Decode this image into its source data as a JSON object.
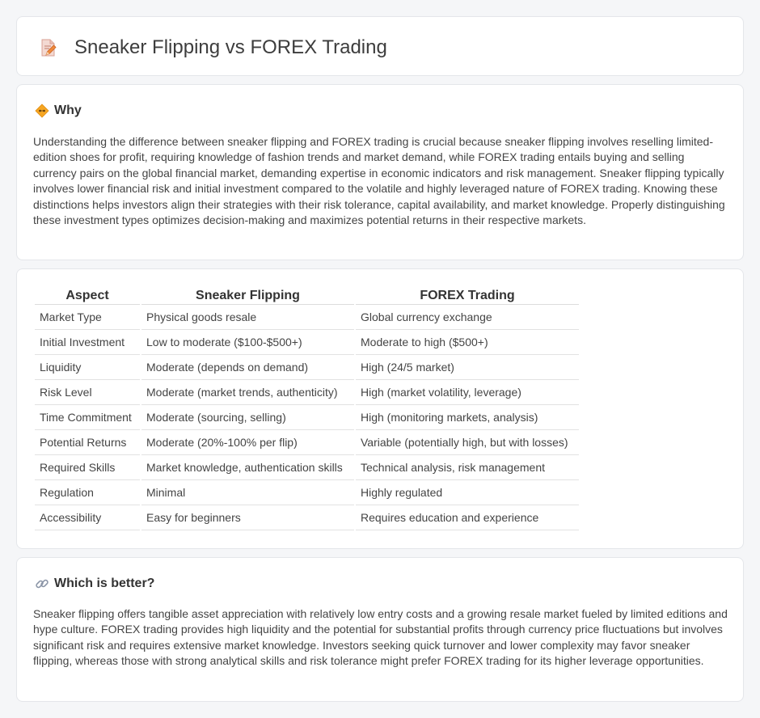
{
  "header": {
    "title": "Sneaker Flipping vs FOREX Trading",
    "icon": "document-pencil-icon"
  },
  "why": {
    "heading": "Why",
    "icon": "diamond-icon",
    "text": "Understanding the difference between sneaker flipping and FOREX trading is crucial because sneaker flipping involves reselling limited-edition shoes for profit, requiring knowledge of fashion trends and market demand, while FOREX trading entails buying and selling currency pairs on the global financial market, demanding expertise in economic indicators and risk management. Sneaker flipping typically involves lower financial risk and initial investment compared to the volatile and highly leveraged nature of FOREX trading. Knowing these distinctions helps investors align their strategies with their risk tolerance, capital availability, and market knowledge. Properly distinguishing these investment types optimizes decision-making and maximizes potential returns in their respective markets."
  },
  "table": {
    "headers": [
      "Aspect",
      "Sneaker Flipping",
      "FOREX Trading"
    ],
    "rows": [
      [
        "Market Type",
        "Physical goods resale",
        "Global currency exchange"
      ],
      [
        "Initial Investment",
        "Low to moderate ($100-$500+)",
        "Moderate to high ($500+)"
      ],
      [
        "Liquidity",
        "Moderate (depends on demand)",
        "High (24/5 market)"
      ],
      [
        "Risk Level",
        "Moderate (market trends, authenticity)",
        "High (market volatility, leverage)"
      ],
      [
        "Time Commitment",
        "Moderate (sourcing, selling)",
        "High (monitoring markets, analysis)"
      ],
      [
        "Potential Returns",
        "Moderate (20%-100% per flip)",
        "Variable (potentially high, but with losses)"
      ],
      [
        "Required Skills",
        "Market knowledge, authentication skills",
        "Technical analysis, risk management"
      ],
      [
        "Regulation",
        "Minimal",
        "Highly regulated"
      ],
      [
        "Accessibility",
        "Easy for beginners",
        "Requires education and experience"
      ]
    ]
  },
  "better": {
    "heading": "Which is better?",
    "icon": "link-icon",
    "text": "Sneaker flipping offers tangible asset appreciation with relatively low entry costs and a growing resale market fueled by limited editions and hype culture. FOREX trading provides high liquidity and the potential for substantial profits through currency price fluctuations but involves significant risk and requires extensive market knowledge. Investors seeking quick turnover and lower complexity may favor sneaker flipping, whereas those with strong analytical skills and risk tolerance might prefer FOREX trading for its higher leverage opportunities."
  }
}
